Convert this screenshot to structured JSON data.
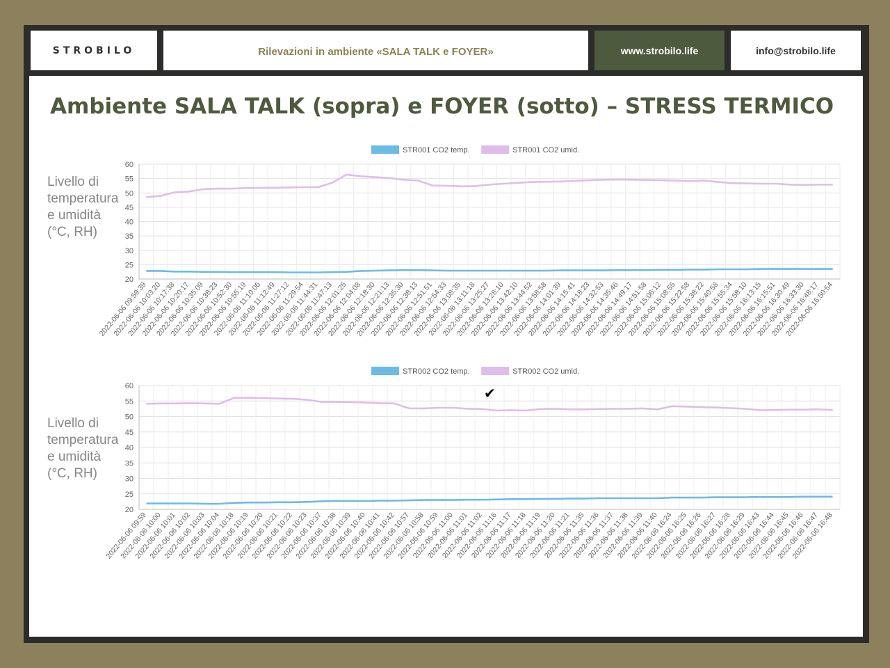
{
  "header": {
    "brand": "STROBILO",
    "subtitle": "Rilevazioni in ambiente «SALA TALK e FOYER»",
    "website": "www.strobilo.life",
    "email": "info@strobilo.life"
  },
  "main": {
    "title": "Ambiente SALA TALK (sopra) e FOYER (sotto) – STRESS TERMICO"
  },
  "chart_data": [
    {
      "type": "line",
      "ylabel": "Livello di temperatura e umidità (°C, RH)",
      "ylim": [
        20,
        60
      ],
      "yticks": [
        20,
        25,
        30,
        35,
        40,
        45,
        50,
        55,
        60
      ],
      "grid": true,
      "legend_position": "top-center",
      "x": [
        "2022-06-06 09:59:39",
        "2022-06-06 10:03:20",
        "2022-06-06 10:17:38",
        "2022-06-06 10:20:17",
        "2022-06-06 10:35:09",
        "2022-06-06 10:38:23",
        "2022-06-06 10:52:30",
        "2022-06-06 10:55:19",
        "2022-06-06 11:10:06",
        "2022-06-06 11:12:49",
        "2022-06-06 11:27:12",
        "2022-06-06 11:29:54",
        "2022-06-06 11:44:31",
        "2022-06-06 11:47:13",
        "2022-06-06 12:01:25",
        "2022-06-06 12:04:08",
        "2022-06-06 12:18:30",
        "2022-06-06 12:21:13",
        "2022-06-06 12:35:30",
        "2022-06-06 12:38:13",
        "2022-06-06 12:51:51",
        "2022-06-06 12:54:33",
        "2022-06-06 13:08:35",
        "2022-06-06 13:11:18",
        "2022-06-06 13:25:27",
        "2022-06-06 13:28:10",
        "2022-06-06 13:42:10",
        "2022-06-06 13:44:52",
        "2022-06-06 13:58:58",
        "2022-06-06 14:01:39",
        "2022-06-06 14:15:41",
        "2022-06-06 14:18:23",
        "2022-06-06 14:32:53",
        "2022-06-06 14:35:46",
        "2022-06-06 14:49:17",
        "2022-06-06 14:51:58",
        "2022-06-06 15:06:12",
        "2022-06-06 15:08:55",
        "2022-06-06 15:22:58",
        "2022-06-06 15:38:22",
        "2022-06-06 15:40:58",
        "2022-06-06 15:55:34",
        "2022-06-06 15:58:10",
        "2022-06-06 16:13:15",
        "2022-06-06 16:15:51",
        "2022-06-06 16:30:49",
        "2022-06-06 16:33:30",
        "2022-06-06 16:48:17",
        "2022-06-06 16:50:54"
      ],
      "series": [
        {
          "name": "STR001 CO2 temp.",
          "color": "#6cbbe5",
          "values": [
            22.8,
            22.8,
            22.6,
            22.6,
            22.5,
            22.5,
            22.4,
            22.4,
            22.4,
            22.4,
            22.3,
            22.3,
            22.3,
            22.4,
            22.5,
            22.8,
            22.9,
            23.0,
            23.1,
            23.1,
            23.0,
            22.9,
            22.9,
            22.9,
            22.9,
            22.9,
            22.9,
            22.9,
            22.9,
            23.0,
            23.0,
            23.0,
            23.0,
            23.1,
            23.1,
            23.1,
            23.2,
            23.2,
            23.3,
            23.3,
            23.4,
            23.4,
            23.4,
            23.5,
            23.5,
            23.5,
            23.5,
            23.5,
            23.5
          ]
        },
        {
          "name": "STR001 CO2 umid.",
          "color": "#dfbdea",
          "values": [
            48.5,
            49.0,
            50.2,
            50.5,
            51.3,
            51.5,
            51.5,
            51.7,
            51.8,
            51.8,
            51.9,
            52.0,
            52.0,
            53.5,
            56.4,
            55.8,
            55.5,
            55.2,
            54.6,
            54.3,
            52.6,
            52.5,
            52.3,
            52.4,
            52.9,
            53.2,
            53.5,
            53.8,
            53.9,
            54.0,
            54.2,
            54.4,
            54.6,
            54.7,
            54.6,
            54.5,
            54.4,
            54.3,
            54.1,
            54.3,
            53.8,
            53.4,
            53.3,
            53.2,
            53.2,
            52.9,
            52.8,
            52.9,
            52.9
          ]
        }
      ]
    },
    {
      "type": "line",
      "ylabel": "Livello di temperatura e umidità (°C, RH)",
      "ylim": [
        20,
        60
      ],
      "yticks": [
        20,
        25,
        30,
        35,
        40,
        45,
        50,
        55,
        60
      ],
      "grid": true,
      "legend_position": "top-center",
      "x": [
        "2022-06-06 09:59",
        "2022-06-06 10:00",
        "2022-06-06 10:01",
        "2022-06-06 10:02",
        "2022-06-06 10:03",
        "2022-06-06 10:04",
        "2022-06-06 10:18",
        "2022-06-06 10:19",
        "2022-06-06 10:20",
        "2022-06-06 10:21",
        "2022-06-06 10:22",
        "2022-06-06 10:23",
        "2022-06-06 10:37",
        "2022-06-06 10:38",
        "2022-06-06 10:39",
        "2022-06-06 10:40",
        "2022-06-06 10:41",
        "2022-06-06 10:42",
        "2022-06-06 10:57",
        "2022-06-06 10:58",
        "2022-06-06 10:59",
        "2022-06-06 11:00",
        "2022-06-06 11:01",
        "2022-06-06 11:02",
        "2022-06-06 11:16",
        "2022-06-06 11:17",
        "2022-06-06 11:18",
        "2022-06-06 11:19",
        "2022-06-06 11:20",
        "2022-06-06 11:21",
        "2022-06-06 11:35",
        "2022-06-06 11:36",
        "2022-06-06 11:37",
        "2022-06-06 11:38",
        "2022-06-06 11:39",
        "2022-06-06 11:40",
        "2022-06-06 16:24",
        "2022-06-06 16:25",
        "2022-06-06 16:26",
        "2022-06-06 16:27",
        "2022-06-06 16:28",
        "2022-06-06 16:29",
        "2022-06-06 16:43",
        "2022-06-06 16:44",
        "2022-06-06 16:45",
        "2022-06-06 16:46",
        "2022-06-06 16:47",
        "2022-06-06 16:48"
      ],
      "series": [
        {
          "name": "STR002 CO2 temp.",
          "color": "#6cbbe5",
          "values": [
            21.9,
            21.9,
            21.9,
            21.9,
            21.8,
            21.8,
            22.1,
            22.2,
            22.2,
            22.3,
            22.3,
            22.4,
            22.6,
            22.7,
            22.7,
            22.7,
            22.8,
            22.8,
            22.9,
            23.0,
            23.0,
            23.0,
            23.1,
            23.1,
            23.2,
            23.3,
            23.3,
            23.4,
            23.4,
            23.5,
            23.5,
            23.6,
            23.6,
            23.6,
            23.6,
            23.6,
            23.8,
            23.8,
            23.8,
            23.9,
            23.9,
            23.9,
            24.0,
            24.0,
            24.0,
            24.1,
            24.1,
            24.1
          ]
        },
        {
          "name": "STR002 CO2 umid.",
          "color": "#dfbdea",
          "values": [
            54.1,
            54.2,
            54.2,
            54.3,
            54.2,
            54.1,
            56.0,
            56.0,
            55.9,
            55.8,
            55.7,
            55.4,
            54.7,
            54.7,
            54.6,
            54.5,
            54.3,
            54.2,
            52.6,
            52.6,
            52.8,
            52.8,
            52.5,
            52.4,
            51.9,
            52.0,
            51.9,
            52.4,
            52.5,
            52.3,
            52.3,
            52.4,
            52.5,
            52.5,
            52.6,
            52.3,
            53.3,
            53.2,
            53.0,
            52.9,
            52.7,
            52.5,
            52.0,
            52.1,
            52.2,
            52.2,
            52.3,
            52.1
          ]
        }
      ]
    }
  ]
}
